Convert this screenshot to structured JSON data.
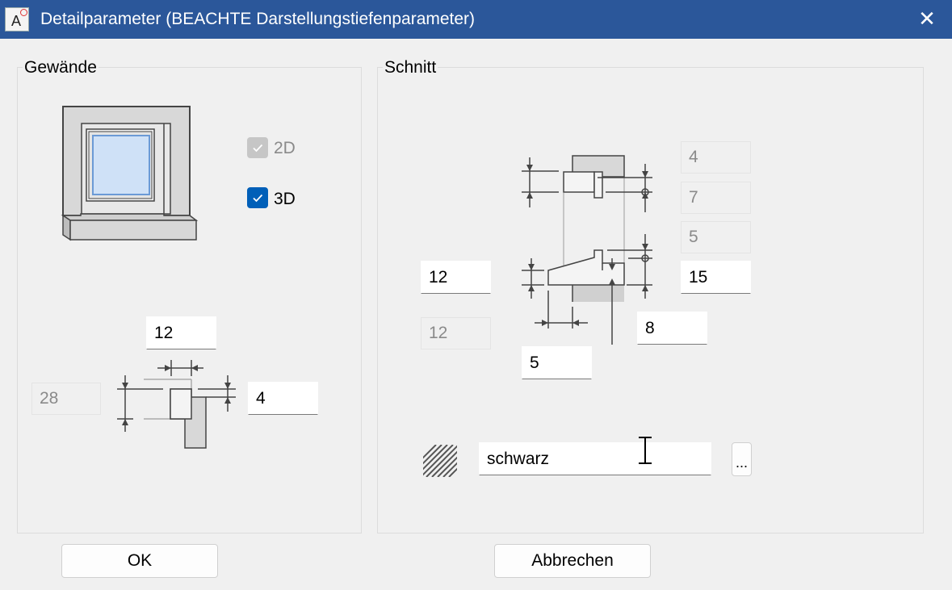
{
  "window": {
    "title": "Detailparameter (BEACHTE Darstellungstiefenparameter)",
    "close_label": "✕",
    "app_icon_letter": "A"
  },
  "gewaende": {
    "label": "Gewände",
    "check_2d": {
      "label": "2D",
      "checked": true,
      "enabled": false
    },
    "check_3d": {
      "label": "3D",
      "checked": true,
      "enabled": true
    },
    "width_value": "12",
    "depth_value": "28",
    "offset_value": "4"
  },
  "schnitt": {
    "label": "Schnitt",
    "top_value_1": "4",
    "top_value_2": "7",
    "top_value_3": "5",
    "right_value": "15",
    "left_value": "12",
    "left_value_disabled": "12",
    "bottom_right_value": "8",
    "bottom_value": "5",
    "hatch_color_value": "schwarz",
    "browse_label": "..."
  },
  "buttons": {
    "ok_label": "OK",
    "cancel_label": "Abbrechen"
  },
  "colors": {
    "titlebar": "#2b579a",
    "checkbox_checked": "#005fb8",
    "checkbox_disabled": "#c6c6c6"
  }
}
